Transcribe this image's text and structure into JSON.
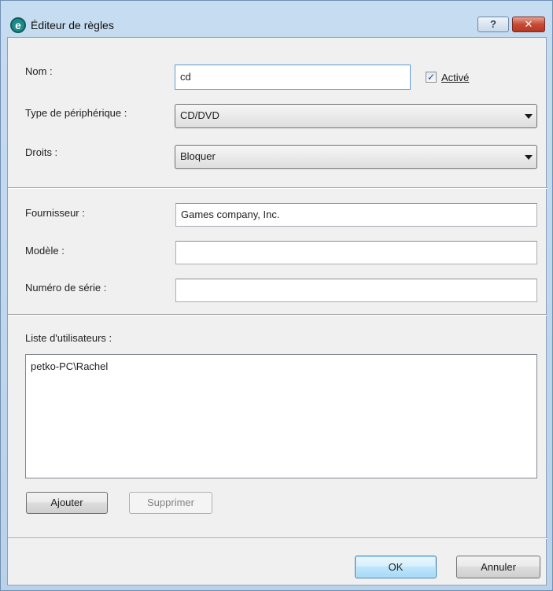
{
  "window": {
    "title": "Éditeur de règles",
    "app_icon_glyph": "e",
    "help_glyph": "?",
    "close_glyph": "✕"
  },
  "form": {
    "name_label": "Nom :",
    "name_value": "cd",
    "active_label": "Activé",
    "active_checked": true,
    "device_type_label": "Type de périphérique :",
    "device_type_value": "CD/DVD",
    "rights_label": "Droits :",
    "rights_value": "Bloquer",
    "vendor_label": "Fournisseur :",
    "vendor_value": "Games company, Inc.",
    "model_label": "Modèle :",
    "model_value": "",
    "serial_label": "Numéro de série :",
    "serial_value": ""
  },
  "users": {
    "label": "Liste d'utilisateurs :",
    "items": [
      "petko-PC\\Rachel"
    ],
    "add_button": "Ajouter",
    "remove_button": "Supprimer"
  },
  "footer": {
    "ok_button": "OK",
    "cancel_button": "Annuler"
  },
  "colors": {
    "title_gradient_top": "#c6dcf0",
    "dialog_bg": "#f0f0f0",
    "close_red": "#c64a34",
    "default_button_border": "#3c7fb1"
  }
}
